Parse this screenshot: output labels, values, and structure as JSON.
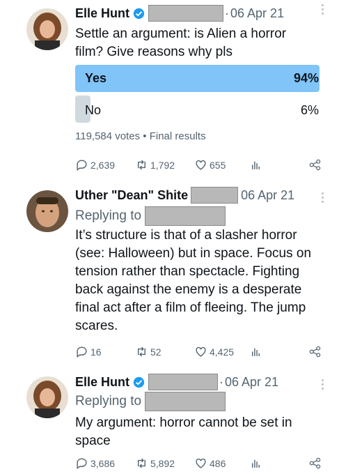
{
  "tweets": [
    {
      "author": "Elle Hunt",
      "date": "06 Apr 21",
      "text_lines": [
        "Settle an argument: is Alien a horror",
        "film? Give reasons why pls"
      ],
      "poll": {
        "options": [
          {
            "label": "Yes",
            "percent_text": "94%",
            "percent": 94,
            "winner": true
          },
          {
            "label": "No",
            "percent_text": "6%",
            "percent": 6,
            "winner": false
          }
        ],
        "votes_summary": "119,584 votes • Final results"
      },
      "actions": {
        "replies": "2,639",
        "retweets": "1,792",
        "likes": "655"
      }
    },
    {
      "author": "Uther \"Dean\" Shite",
      "date": "06 Apr 21",
      "replying_to": "Replying to",
      "text_lines": [
        "It’s structure is that of a slasher horror",
        "(see: Halloween) but in space. Focus on",
        "tension rather than spectacle. Fighting",
        "back against the enemy is a desperate",
        "final act after a film of fleeing. The jump",
        "scares."
      ],
      "actions": {
        "replies": "16",
        "retweets": "52",
        "likes": "4,425"
      }
    },
    {
      "author": "Elle Hunt",
      "date": "06 Apr 21",
      "replying_to": "Replying to",
      "text_lines": [
        "My argument: horror cannot be set in",
        "space"
      ],
      "actions": {
        "replies": "3,686",
        "retweets": "5,892",
        "likes": "486"
      }
    }
  ],
  "colors": {
    "poll_winner": "#80c4f8",
    "poll_loser": "#cfd9de",
    "verified": "#1d9bf0",
    "muted": "#536471"
  },
  "icons": [
    "verified-badge-icon",
    "reply-icon",
    "retweet-icon",
    "like-icon",
    "views-icon",
    "share-icon",
    "more-icon"
  ]
}
